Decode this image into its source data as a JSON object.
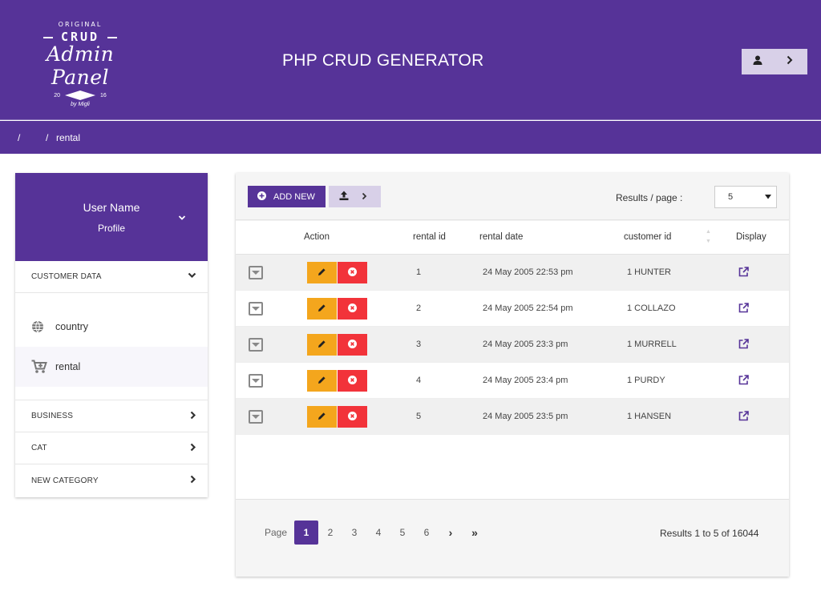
{
  "app": {
    "title": "PHP CRUD GENERATOR"
  },
  "logo": {
    "line1": "ORIGINAL",
    "line2": "CRUD",
    "line3": "Admin Panel",
    "year_left": "20",
    "year_right": "16",
    "byline": "by Migli"
  },
  "breadcrumb": {
    "sep1": "/",
    "sep2": "/",
    "current": "rental"
  },
  "user": {
    "name": "User Name",
    "profile": "Profile"
  },
  "sidebar": {
    "customer_data": {
      "label": "CUSTOMER DATA",
      "items": [
        {
          "label": "country",
          "icon": "globe-icon"
        },
        {
          "label": "rental",
          "icon": "cart-plus-icon"
        }
      ]
    },
    "business": {
      "label": "BUSINESS"
    },
    "cat": {
      "label": "CAT"
    },
    "new_category": {
      "label": "NEW CATEGORY"
    }
  },
  "toolbar": {
    "add_label": "ADD NEW",
    "results_label": "Results / page :",
    "results_value": "5"
  },
  "table": {
    "columns": {
      "action": "Action",
      "rental_id": "rental id",
      "rental_date": "rental date",
      "customer_id": "customer id",
      "display": "Display"
    },
    "rows": [
      {
        "rental_id": "1",
        "rental_date": "24 May 2005 22:53 pm",
        "customer_id": "1 HUNTER"
      },
      {
        "rental_id": "2",
        "rental_date": "24 May 2005 22:54 pm",
        "customer_id": "1 COLLAZO"
      },
      {
        "rental_id": "3",
        "rental_date": "24 May 2005 23:3 pm",
        "customer_id": "1 MURRELL"
      },
      {
        "rental_id": "4",
        "rental_date": "24 May 2005 23:4 pm",
        "customer_id": "1 PURDY"
      },
      {
        "rental_id": "5",
        "rental_date": "24 May 2005 23:5 pm",
        "customer_id": "1 HANSEN"
      }
    ]
  },
  "pagination": {
    "label": "Page",
    "pages": [
      "1",
      "2",
      "3",
      "4",
      "5",
      "6"
    ],
    "current": "1",
    "next": "›",
    "last": "»",
    "summary": "Results 1 to 5 of 16044"
  },
  "colors": {
    "primary": "#563398",
    "light_accent": "#d8d0e8",
    "edit": "#f4a61d",
    "delete": "#f2333a"
  }
}
